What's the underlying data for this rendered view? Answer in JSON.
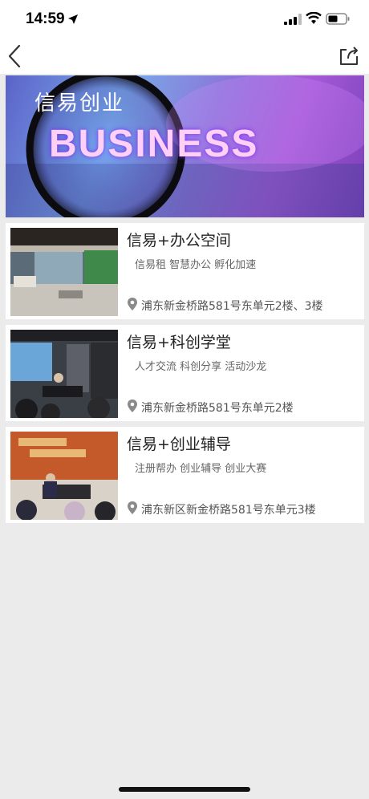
{
  "status_bar": {
    "time": "14:59",
    "icons": [
      "location-arrow-icon",
      "cellular-signal-icon",
      "wifi-icon",
      "battery-icon"
    ]
  },
  "nav": {
    "back_icon": "chevron-left-icon",
    "share_icon": "share-icon"
  },
  "banner": {
    "title": "信易创业",
    "background_words": [
      "BUSINESS"
    ]
  },
  "items": [
    {
      "name": "信易+办公空间",
      "tags": "信易租 智慧办公 孵化加速",
      "address": "浦东新金桥路581号东单元2楼、3楼",
      "thumb_icon": "office-space-photo"
    },
    {
      "name": "信易+科创学堂",
      "tags": "人才交流 科创分享 活动沙龙",
      "address": "浦东新金桥路581号东单元2楼",
      "thumb_icon": "classroom-photo"
    },
    {
      "name": "信易+创业辅导",
      "tags": "注册帮办 创业辅导 创业大赛",
      "address": "浦东新区新金桥路581号东单元3楼",
      "thumb_icon": "meeting-photo"
    }
  ],
  "colors": {
    "background": "#ebebeb",
    "card": "#ffffff",
    "banner_start": "#5b63c9",
    "banner_end": "#7a3fb8"
  }
}
